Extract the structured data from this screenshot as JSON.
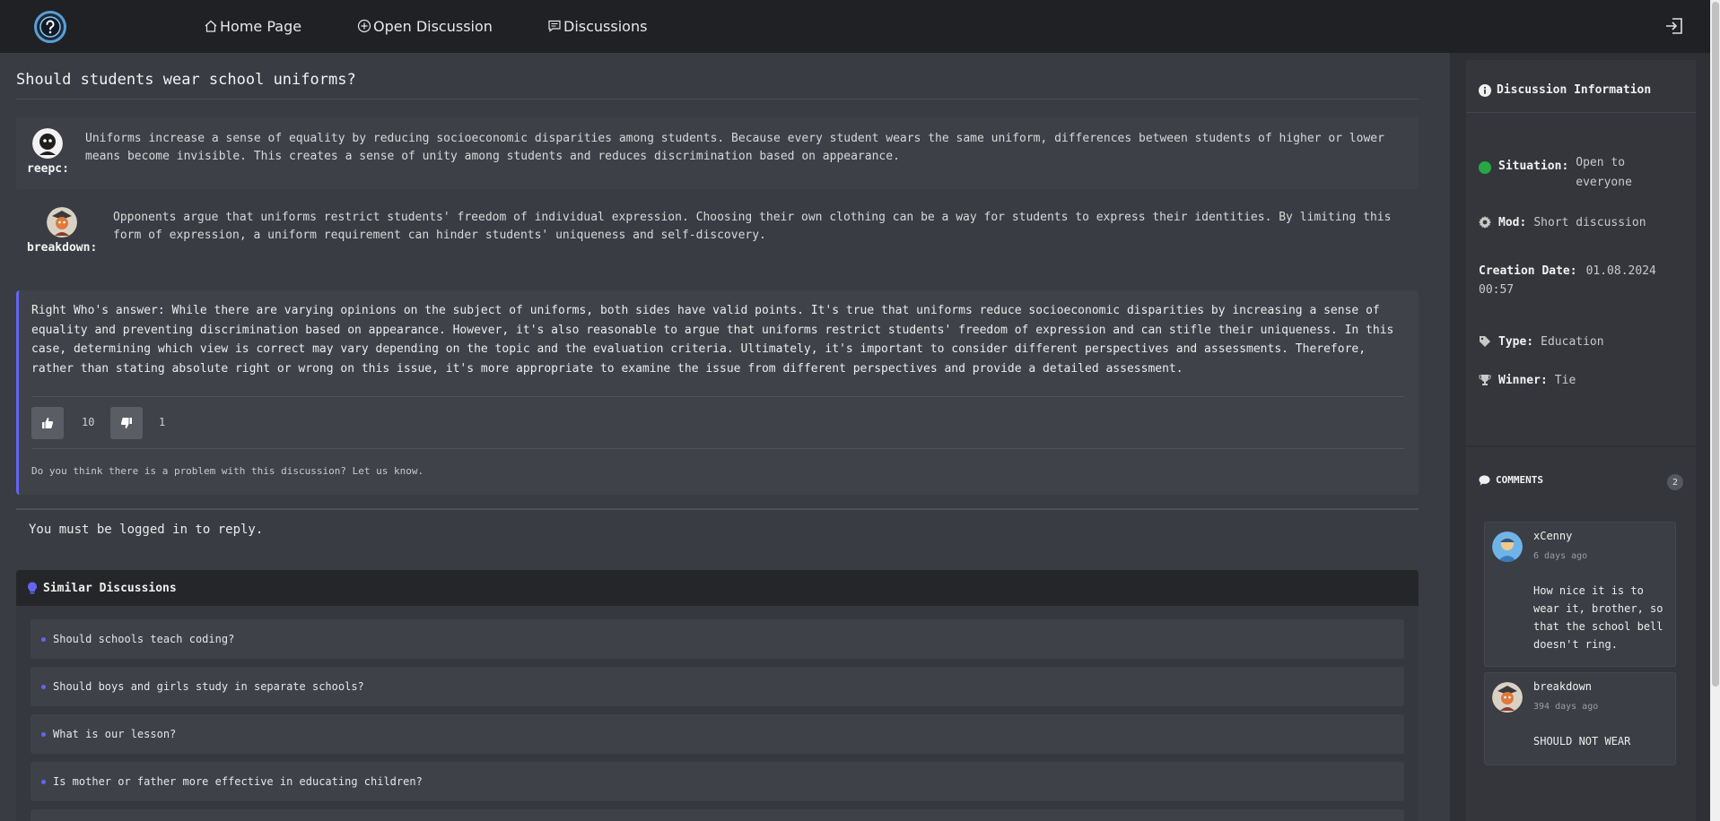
{
  "nav": {
    "home": "Home Page",
    "open_discussion": "Open Discussion",
    "discussions": "Discussions"
  },
  "discussion": {
    "title": "Should students wear school uniforms?",
    "posts": [
      {
        "author": "reepc:",
        "text": "Uniforms increase a sense of equality by reducing socioeconomic disparities among students. Because every student wears the same uniform, differences between students of higher or lower means become invisible. This creates a sense of unity among students and reduces discrimination based on appearance."
      },
      {
        "author": "breakdown:",
        "text": "Opponents argue that uniforms restrict students' freedom of individual expression. Choosing their own clothing can be a way for students to express their identities. By limiting this form of expression, a uniform requirement can hinder students' uniqueness and self-discovery."
      }
    ],
    "answer": {
      "text": "Right Who's answer: While there are varying opinions on the subject of uniforms, both sides have valid points. It's true that uniforms reduce socioeconomic disparities by increasing a sense of equality and preventing discrimination based on appearance. However, it's also reasonable to argue that uniforms restrict students' freedom of expression and can stifle their uniqueness. In this case, determining which view is correct may vary depending on the topic and the evaluation criteria. Ultimately, it's important to consider different perspectives and assessments. Therefore, rather than stating absolute right or wrong on this issue, it's more appropriate to examine the issue from different perspectives and provide a detailed assessment.",
      "likes": "10",
      "dislikes": "1",
      "report": "Do you think there is a problem with this discussion? Let us know."
    },
    "login_message": "You must be logged in to reply."
  },
  "similar": {
    "title": "Similar Discussions",
    "items": [
      "Should schools teach coding?",
      "Should boys and girls study in separate schools?",
      "What is our lesson?",
      "Is mother or father more effective in educating children?"
    ]
  },
  "info": {
    "title": "Discussion Information",
    "situation_label": "Situation:",
    "situation_value_1": "Open to",
    "situation_value_2": "everyone",
    "mod_label": "Mod:",
    "mod_value": "Short discussion",
    "date_label": "Creation Date:",
    "date_value_1": "01.08.2024",
    "date_value_2": "00:57",
    "type_label": "Type:",
    "type_value": "Education",
    "winner_label": "Winner:",
    "winner_value": "Tie",
    "status_color": "#28a745"
  },
  "comments": {
    "title": "COMMENTS",
    "count": "2",
    "items": [
      {
        "user": "xCenny",
        "time": "6 days ago",
        "lines": [
          "How nice it is to",
          "wear it, brother, so",
          "that the school bell",
          "doesn't ring."
        ]
      },
      {
        "user": "breakdown",
        "time": "394 days ago",
        "lines": [
          "SHOULD NOT WEAR"
        ]
      }
    ]
  },
  "colors": {
    "accent": "#6366f1",
    "topbar": "#202124",
    "background": "#393c43"
  }
}
